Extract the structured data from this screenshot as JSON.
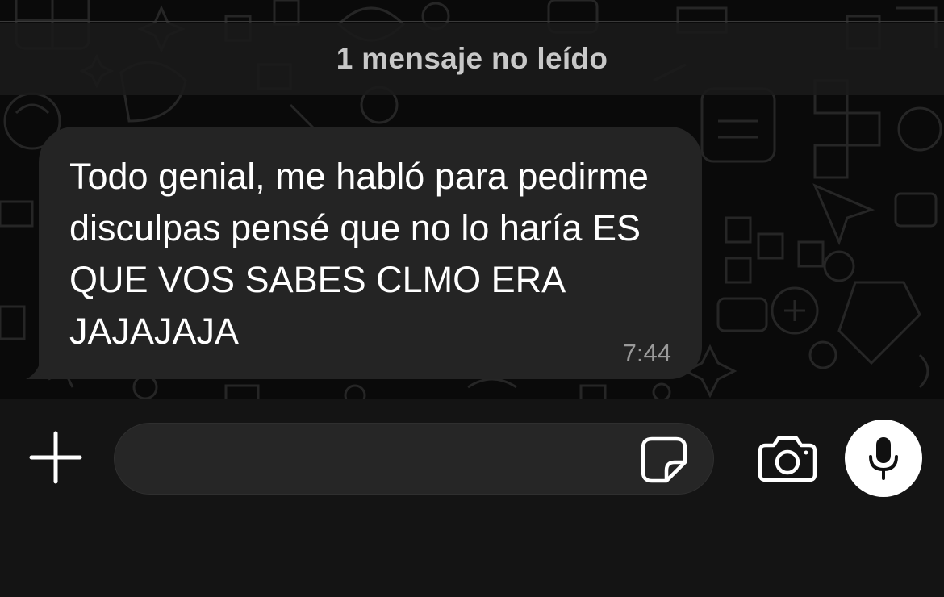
{
  "banner": {
    "unread_label": "1 mensaje no leído"
  },
  "message": {
    "text": "Todo genial, me habló para pedirme disculpas pensé que no lo haría ES QUE VOS SABES CLMO ERA JAJAJAJA",
    "time": "7:44",
    "direction": "incoming"
  },
  "composer": {
    "value": "",
    "placeholder": ""
  },
  "icons": {
    "attach": "plus-icon",
    "sticker": "sticker-icon",
    "camera": "camera-icon",
    "mic": "microphone-icon"
  },
  "theme": {
    "background": "#0a0a0a",
    "bubble": "#242424",
    "text": "#ffffff",
    "timestamp": "#9a9a9a",
    "mic_button": "#ffffff"
  }
}
